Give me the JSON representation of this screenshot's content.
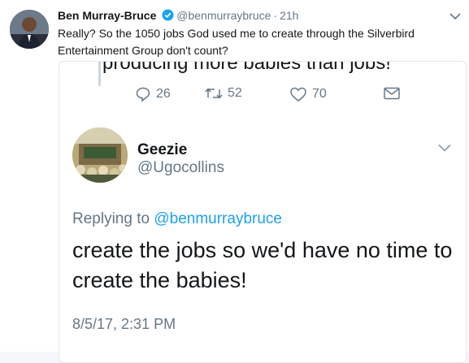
{
  "tweet": {
    "author_name": "Ben Murray-Bruce",
    "handle": "@benmurraybruce",
    "separator": "·",
    "time": "21h",
    "text": "Really? So the 1050 jobs God used me to create through the Silverbird Entertainment Group don't count?"
  },
  "quoted": {
    "clipped_text": "producing more babies than jobs!",
    "actions": {
      "replies": "26",
      "retweets": "52",
      "likes": "70"
    },
    "author_name": "Geezie",
    "handle": "@Ugocollins",
    "replying_prefix": "Replying to ",
    "replying_mention": "@benmurraybruce",
    "text": "create the jobs so we'd have no time to create the babies!",
    "date": "8/5/17, 2:31 PM"
  },
  "colors": {
    "accent": "#1da1f2",
    "muted": "#657786",
    "text": "#14171a",
    "border": "#e1e8ed"
  }
}
